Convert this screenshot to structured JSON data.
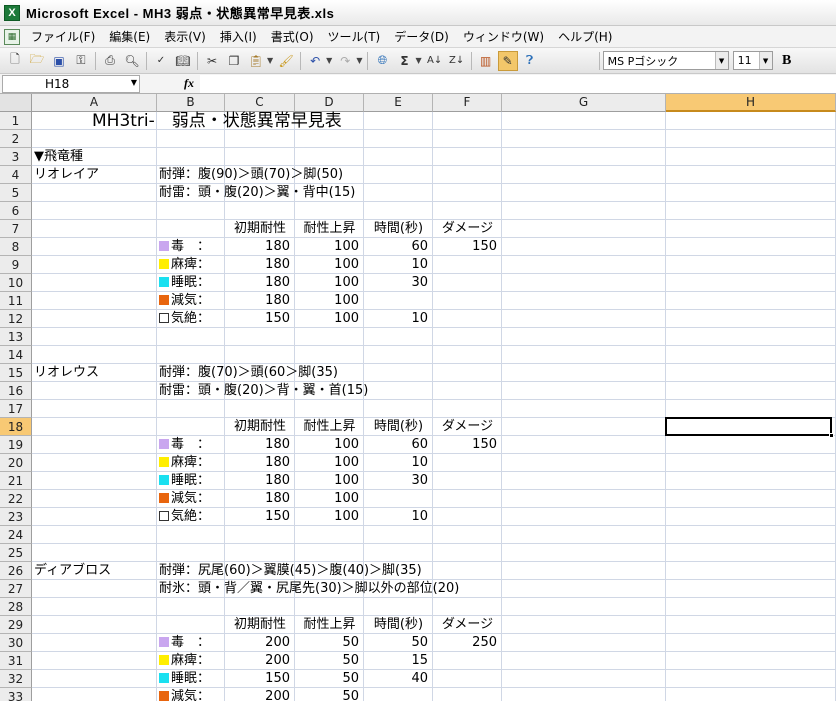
{
  "window": {
    "title": "Microsoft Excel - MH3 弱点・状態異常早見表.xls",
    "app_icon_glyph": "X"
  },
  "menu": [
    "ファイル(F)",
    "編集(E)",
    "表示(V)",
    "挿入(I)",
    "書式(O)",
    "ツール(T)",
    "データ(D)",
    "ウィンドウ(W)",
    "ヘルプ(H)"
  ],
  "toolbar": {
    "font_name": "MS Pゴシック",
    "font_size": "11",
    "bold_label": "B"
  },
  "formula_bar": {
    "name_box": "H18",
    "fx_label": "fx",
    "content": ""
  },
  "selected_cell": {
    "column": "H",
    "row": 18
  },
  "columns": [
    "A",
    "B",
    "C",
    "D",
    "E",
    "F",
    "G",
    "H"
  ],
  "rows": [
    1,
    2,
    3,
    4,
    5,
    6,
    7,
    8,
    9,
    10,
    11,
    12,
    13,
    14,
    15,
    16,
    17,
    18,
    19,
    20,
    21,
    22,
    23,
    24,
    25,
    26,
    27,
    28,
    29,
    30,
    31,
    32,
    33
  ],
  "colors": {
    "poison": "#c9a6ef",
    "paralysis": "#ffee00",
    "sleep": "#1ae0f0",
    "exhaust": "#e8650e",
    "selection_header": "#f8c974"
  },
  "cells": {
    "r1": {
      "title": "MH3tri-　弱点・状態異常早見表"
    },
    "r3": {
      "a": "▼飛竜種"
    },
    "r4": {
      "a": "リオレイア",
      "b": "耐弾：腹(90)＞頭(70)＞脚(50)"
    },
    "r5": {
      "b": "耐雷：頭・腹(20)＞翼・背中(15)"
    },
    "r7": {
      "c": "初期耐性",
      "d": "耐性上昇",
      "e": "時間(秒)",
      "f": "ダメージ"
    },
    "r8": {
      "b": "毒　：",
      "c": "180",
      "d": "100",
      "e": "60",
      "f": "150"
    },
    "r9": {
      "b": "麻痺：",
      "c": "180",
      "d": "100",
      "e": "10"
    },
    "r10": {
      "b": "睡眠：",
      "c": "180",
      "d": "100",
      "e": "30"
    },
    "r11": {
      "b": "減気：",
      "c": "180",
      "d": "100"
    },
    "r12": {
      "b": "気絶：",
      "c": "150",
      "d": "100",
      "e": "10"
    },
    "r15": {
      "a": "リオレウス",
      "b": "耐弾：腹(70)＞頭(60＞脚(35)"
    },
    "r16": {
      "b": "耐雷：頭・腹(20)＞背・翼・首(15)"
    },
    "r18": {
      "c": "初期耐性",
      "d": "耐性上昇",
      "e": "時間(秒)",
      "f": "ダメージ"
    },
    "r19": {
      "b": "毒　：",
      "c": "180",
      "d": "100",
      "e": "60",
      "f": "150"
    },
    "r20": {
      "b": "麻痺：",
      "c": "180",
      "d": "100",
      "e": "10"
    },
    "r21": {
      "b": "睡眠：",
      "c": "180",
      "d": "100",
      "e": "30"
    },
    "r22": {
      "b": "減気：",
      "c": "180",
      "d": "100"
    },
    "r23": {
      "b": "気絶：",
      "c": "150",
      "d": "100",
      "e": "10"
    },
    "r26": {
      "a": "ディアブロス",
      "b": "耐弾：尻尾(60)＞翼膜(45)＞腹(40)＞脚(35)"
    },
    "r27": {
      "b": "耐氷：頭・背／翼・尻尾先(30)＞脚以外の部位(20)"
    },
    "r29": {
      "c": "初期耐性",
      "d": "耐性上昇",
      "e": "時間(秒)",
      "f": "ダメージ"
    },
    "r30": {
      "b": "毒　：",
      "c": "200",
      "d": "50",
      "e": "50",
      "f": "250"
    },
    "r31": {
      "b": "麻痺：",
      "c": "200",
      "d": "50",
      "e": "15"
    },
    "r32": {
      "b": "睡眠：",
      "c": "150",
      "d": "50",
      "e": "40"
    },
    "r33": {
      "b": "減気：",
      "c": "200",
      "d": "50"
    }
  }
}
